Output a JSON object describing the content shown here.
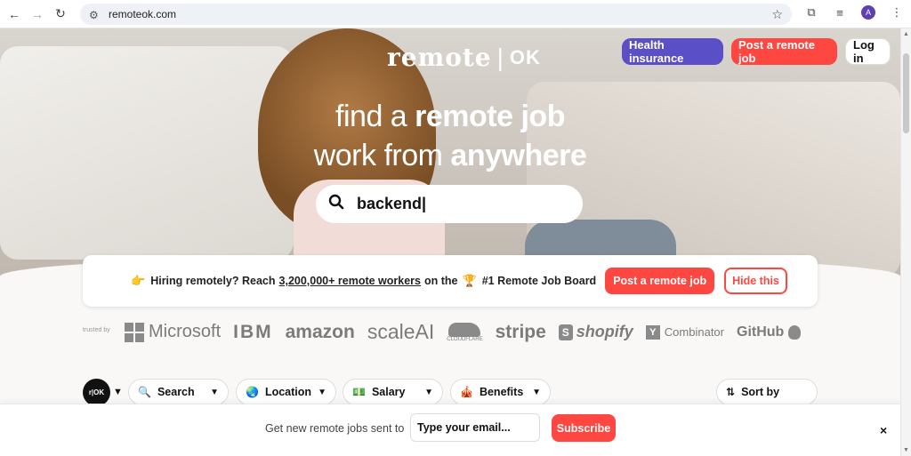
{
  "browser": {
    "url": "remoteok.com",
    "avatar_letter": "A"
  },
  "header": {
    "logo_word": "remote",
    "logo_sep": "|",
    "logo_ok": "OK",
    "health_label": "Health insurance",
    "post_label": "Post a remote job",
    "login_label": "Log in"
  },
  "hero": {
    "line1_light": "find a ",
    "line1_bold": "remote job",
    "line2_light": "work from ",
    "line2_bold": "anywhere",
    "search_value": "backend|"
  },
  "banner": {
    "emoji": "👉",
    "text_a": "Hiring remotely? Reach",
    "link": "3,200,000+ remote workers",
    "text_b": "on the",
    "trophy": "🏆",
    "text_c": "#1 Remote Job Board",
    "cta": "Post a remote job",
    "hide": "Hide this"
  },
  "trusted": {
    "label": "trusted by",
    "brands": [
      "Microsoft",
      "IBM",
      "amazon",
      "scaleAI",
      "CLOUDFLARE",
      "stripe",
      "shopify",
      "Combinator",
      "GitHub"
    ]
  },
  "filters": {
    "logo_text": "r|OK",
    "search": "Search",
    "location": "Location",
    "salary": "Salary",
    "benefits": "Benefits",
    "sort": "Sort by"
  },
  "subscribe": {
    "label": "Get new remote jobs sent to",
    "placeholder": "Type your email...",
    "button": "Subscribe",
    "close": "×"
  },
  "colors": {
    "accent": "#ff4742",
    "health": "#5b4fc7"
  }
}
